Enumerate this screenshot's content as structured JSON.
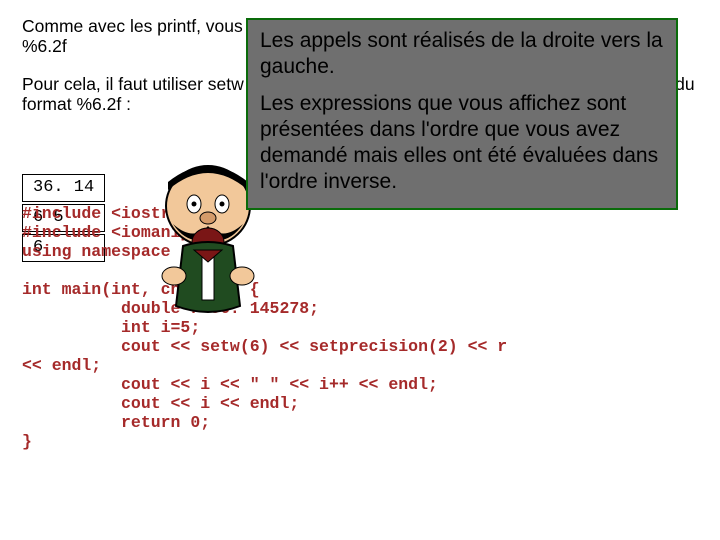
{
  "text": {
    "para1": "Comme avec les printf, vous pouvez indiquer un format d'affichage à la manière des %6.2f",
    "para2": "Pour cela, il faut utiliser setw et setprecision, le programme suivant créé l'équivalent du format %6.2f :"
  },
  "outputs": {
    "v1": " 36. 14",
    "v2": "6 5",
    "v3": "6"
  },
  "code": {
    "l1": "#include <iostream>",
    "l2": "#include <iomanip>",
    "l3": "using namespace std;",
    "l4": "",
    "l5": "int main(int, char **) {",
    "l6": "          double r=36. 145278;",
    "l7": "          int i=5;",
    "l8": "          cout << setw(6) << setprecision(2) << r",
    "l9": "<< endl;",
    "l10": "          cout << i << \" \" << i++ << endl;",
    "l11": "          cout << i << endl;",
    "l12": "          return 0;",
    "l13": "}"
  },
  "tooltip": {
    "line1": "Les appels sont réalisés de la droite vers la gauche.",
    "line2": "Les expressions que vous affichez sont présentées dans l'ordre que vous avez demandé mais elles ont été évaluées dans l'ordre inverse."
  },
  "mascot": {
    "emoji": "👨🏻",
    "bow": "🧐"
  }
}
